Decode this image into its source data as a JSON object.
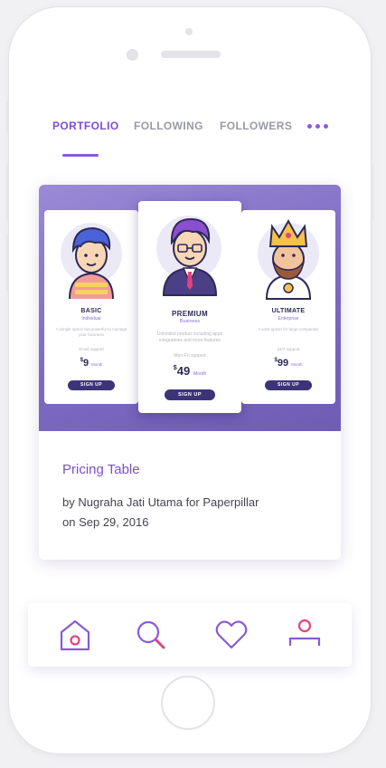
{
  "tabs": [
    {
      "label": "PORTFOLIO",
      "active": true
    },
    {
      "label": "FOLLOWING",
      "active": false
    },
    {
      "label": "FOLLOWERS",
      "active": false
    }
  ],
  "card": {
    "title": "Pricing Table",
    "author_line": "by Nugraha Jati Utama for Paperpillar",
    "date_line": "on Sep 29, 2016",
    "plans": [
      {
        "name": "BASIC",
        "subtitle": "Individual",
        "description": "A simple option but powerful to manage your business",
        "support": "Email support",
        "currency": "$",
        "price": "9",
        "period": "Month",
        "button": "SIGN UP"
      },
      {
        "name": "PREMIUM",
        "subtitle": "Business",
        "description": "Unlimited product including apps integrations and more features",
        "support": "Mon-Fri support",
        "currency": "$",
        "price": "49",
        "period": "Month",
        "button": "SIGN UP"
      },
      {
        "name": "ULTIMATE",
        "subtitle": "Enterprise",
        "description": "A wise option for large companies",
        "support": "24/7 support",
        "currency": "$",
        "price": "99",
        "period": "Month",
        "button": "SIGN UP"
      }
    ]
  },
  "bottom_nav": [
    {
      "icon": "home-icon",
      "active": true
    },
    {
      "icon": "search-icon",
      "active": false
    },
    {
      "icon": "heart-icon",
      "active": false
    },
    {
      "icon": "profile-icon",
      "active": false
    }
  ],
  "colors": {
    "accent": "#7b4fd1",
    "accent_pink": "#e0457b",
    "text_muted": "#9a9aa6",
    "card_bg_purple": "#7d6ac2"
  }
}
